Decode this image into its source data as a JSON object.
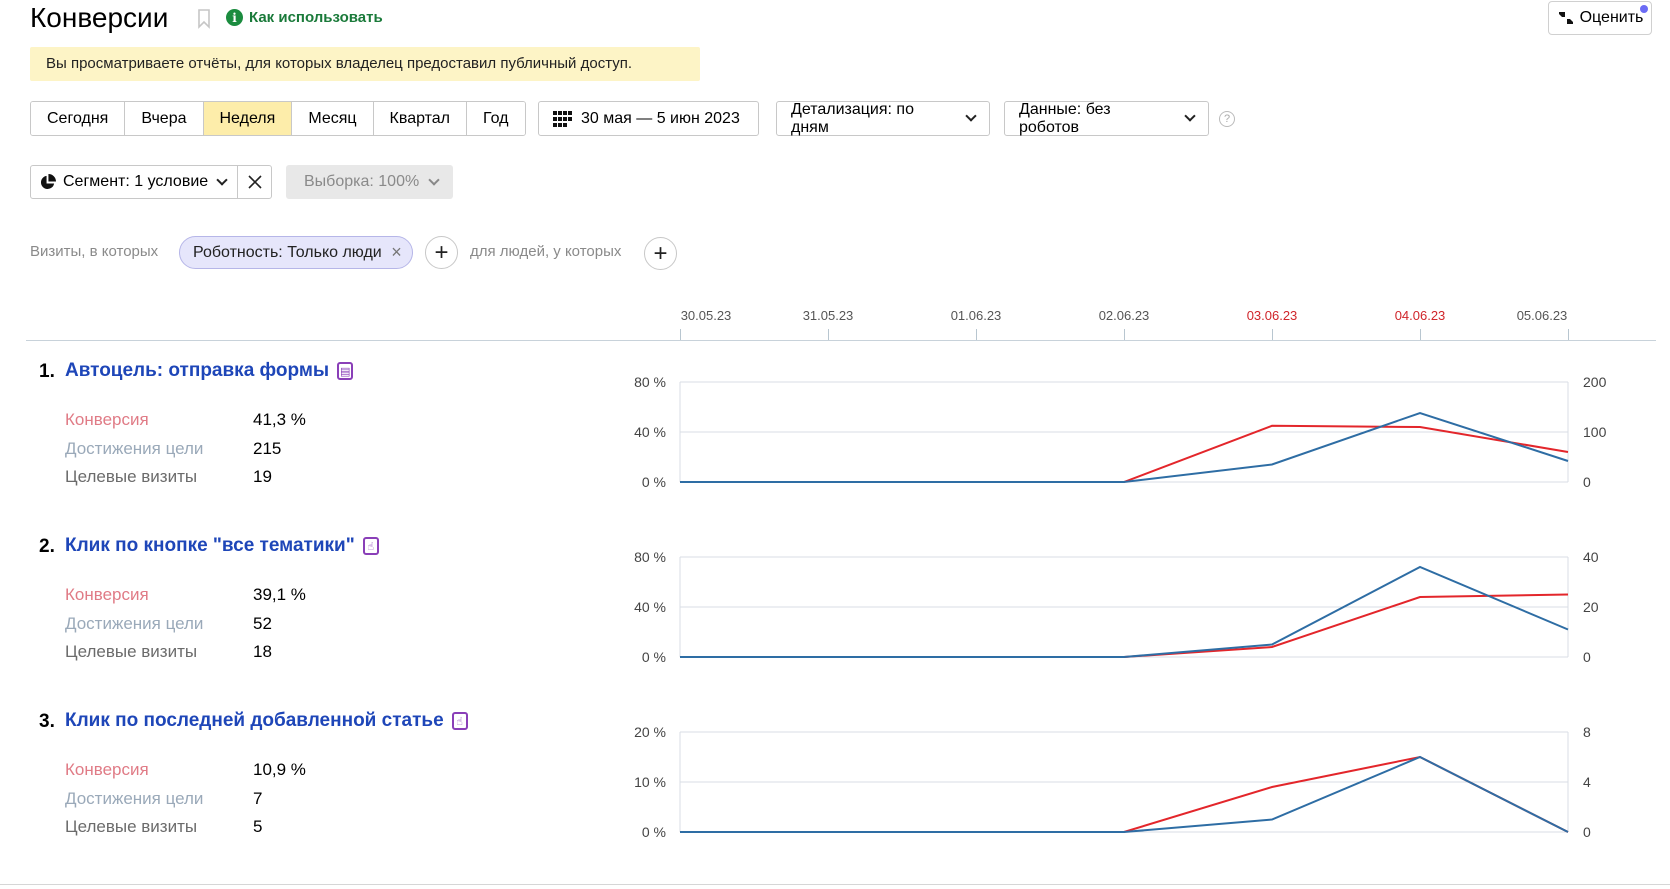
{
  "header": {
    "title": "Конверсии",
    "howto_label": "Как использовать",
    "rate_label": "Оценить"
  },
  "notice": "Вы просматриваете отчёты, для которых владелец предоставил публичный доступ.",
  "period_tabs": [
    {
      "label": "Сегодня",
      "active": false
    },
    {
      "label": "Вчера",
      "active": false
    },
    {
      "label": "Неделя",
      "active": true
    },
    {
      "label": "Месяц",
      "active": false
    },
    {
      "label": "Квартал",
      "active": false
    },
    {
      "label": "Год",
      "active": false
    }
  ],
  "date_range": "30 мая — 5 июн 2023",
  "detail": "Детализация: по дням",
  "data_filter": "Данные: без роботов",
  "help_glyph": "?",
  "segment": {
    "label": "Сегмент: 1 условие",
    "sample": "Выборка: 100%"
  },
  "conditions": {
    "visits_label": "Визиты, в которых",
    "chip_label": "Роботность: Только люди",
    "people_label": "для людей, у которых"
  },
  "timeline": {
    "dates": [
      "30.05.23",
      "31.05.23",
      "01.06.23",
      "02.06.23",
      "03.06.23",
      "04.06.23",
      "05.06.23"
    ],
    "weekend": [
      false,
      false,
      false,
      false,
      true,
      true,
      false
    ]
  },
  "colors": {
    "conversion": "#e3262b",
    "achievements": "#2e6da4",
    "link": "#1e46b8",
    "active_tab": "#fdedaa"
  },
  "metric_labels": {
    "conversion": "Конверсия",
    "achievements": "Достижения цели",
    "visits": "Целевые визиты"
  },
  "goals": [
    {
      "num": "1.",
      "title": "Автоцель: отправка формы",
      "icon": "form-icon",
      "conversion": "41,3 %",
      "achievements": "215",
      "visits": "19"
    },
    {
      "num": "2.",
      "title": "Клик по кнопке \"все тематики\"",
      "icon": "click-icon",
      "conversion": "39,1 %",
      "achievements": "52",
      "visits": "18"
    },
    {
      "num": "3.",
      "title": "Клик по последней добавленной статье",
      "icon": "click-icon",
      "conversion": "10,9 %",
      "achievements": "7",
      "visits": "5"
    }
  ],
  "chart_data": [
    {
      "type": "line",
      "x": [
        "30.05.23",
        "31.05.23",
        "01.06.23",
        "02.06.23",
        "03.06.23",
        "04.06.23",
        "05.06.23"
      ],
      "left_axis": {
        "ticks": [
          "80 %",
          "40 %",
          "0 %"
        ],
        "ylim": [
          0,
          80
        ]
      },
      "right_axis": {
        "ticks": [
          "200",
          "100",
          "0"
        ],
        "ylim": [
          0,
          200
        ]
      },
      "series": [
        {
          "axis": "left",
          "color": "#e3262b",
          "values": [
            0,
            0,
            0,
            0,
            45,
            44,
            24
          ]
        },
        {
          "axis": "right",
          "color": "#2e6da4",
          "values": [
            0,
            0,
            0,
            0,
            35,
            138,
            42
          ]
        }
      ]
    },
    {
      "type": "line",
      "x": [
        "30.05.23",
        "31.05.23",
        "01.06.23",
        "02.06.23",
        "03.06.23",
        "04.06.23",
        "05.06.23"
      ],
      "left_axis": {
        "ticks": [
          "80 %",
          "40 %",
          "0 %"
        ],
        "ylim": [
          0,
          80
        ]
      },
      "right_axis": {
        "ticks": [
          "40",
          "20",
          "0"
        ],
        "ylim": [
          0,
          40
        ]
      },
      "series": [
        {
          "axis": "left",
          "color": "#e3262b",
          "values": [
            0,
            0,
            0,
            0,
            8,
            48,
            50
          ]
        },
        {
          "axis": "right",
          "color": "#2e6da4",
          "values": [
            0,
            0,
            0,
            0,
            5,
            36,
            11
          ]
        }
      ]
    },
    {
      "type": "line",
      "x": [
        "30.05.23",
        "31.05.23",
        "01.06.23",
        "02.06.23",
        "03.06.23",
        "04.06.23",
        "05.06.23"
      ],
      "left_axis": {
        "ticks": [
          "20 %",
          "10 %",
          "0 %"
        ],
        "ylim": [
          0,
          20
        ]
      },
      "right_axis": {
        "ticks": [
          "8",
          "4",
          "0"
        ],
        "ylim": [
          0,
          8
        ]
      },
      "series": [
        {
          "axis": "left",
          "color": "#e3262b",
          "values": [
            0,
            0,
            0,
            0,
            9,
            15,
            0
          ]
        },
        {
          "axis": "right",
          "color": "#2e6da4",
          "values": [
            0,
            0,
            0,
            0,
            1,
            6,
            0
          ]
        }
      ]
    }
  ]
}
